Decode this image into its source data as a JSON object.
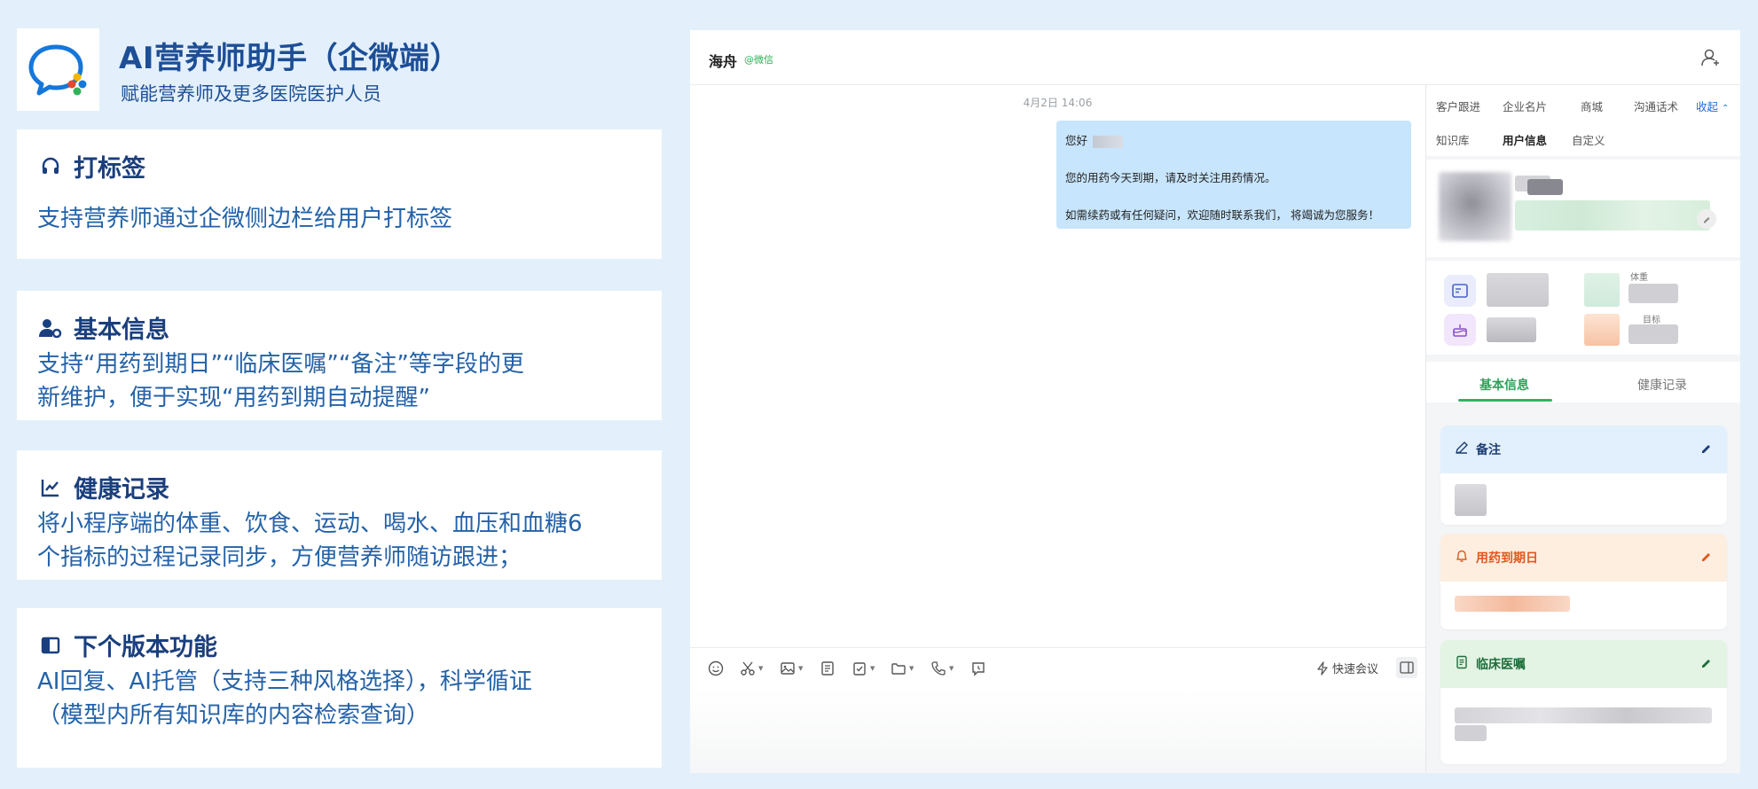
{
  "header": {
    "title": "AI营养师助手（企微端）",
    "subtitle": "赋能营养师及更多医院医护人员"
  },
  "features": [
    {
      "title": "打标签",
      "desc": "支持营养师通过企微侧边栏给用户打标签"
    },
    {
      "title": "基本信息",
      "desc_lines": [
        "支持“用药到期日”“临床医嘱”“备注”等字段的更",
        "新维护，便于实现“用药到期自动提醒”"
      ]
    },
    {
      "title": "健康记录",
      "desc_lines": [
        "将小程序端的体重、饮食、运动、喝水、血压和血糖6",
        "个指标的过程记录同步，方便营养师随访跟进；"
      ]
    },
    {
      "title": "下个版本功能",
      "desc_lines": [
        "AI回复、AI托管（支持三种风格选择），科学循证",
        "（模型内所有知识库的内容检索查询）"
      ]
    }
  ],
  "chat": {
    "contact_name": "海舟",
    "contact_tag": "@微信",
    "timestamp": "4月2日 14:06",
    "message": {
      "greeting": "您好",
      "line1": "您的用药今天到期，请及时关注用药情况。",
      "line2": "如需续药或有任何疑问，欢迎随时联系我们， 将竭诚为您服务！"
    },
    "toolbar": {
      "quick_meeting": "快速会议"
    }
  },
  "crm": {
    "tabs_row1": [
      "客户跟进",
      "企业名片",
      "商城",
      "沟通话术"
    ],
    "collapse_label": "收起",
    "collapse_arrow": "⌃",
    "tabs_row2": [
      "知识库",
      "用户信息",
      "自定义"
    ],
    "active_tab": "用户信息",
    "stat_labels": {
      "weight": "体重",
      "target": "目标"
    },
    "info_tabs": [
      "基本信息",
      "健康记录"
    ],
    "sections": [
      {
        "title": "备注",
        "color": "#1d3e73",
        "bg": "#e2effd"
      },
      {
        "title": "用药到期日",
        "color": "#e0581e",
        "bg": "#fdeee0"
      },
      {
        "title": "临床医嘱",
        "color": "#1d6e3a",
        "bg": "#e3f3e4"
      }
    ]
  },
  "colors": {
    "accent_blue": "#1d4e96",
    "text_blue": "#2462a8",
    "bubble": "#c7e5fc",
    "green": "#34b067"
  }
}
